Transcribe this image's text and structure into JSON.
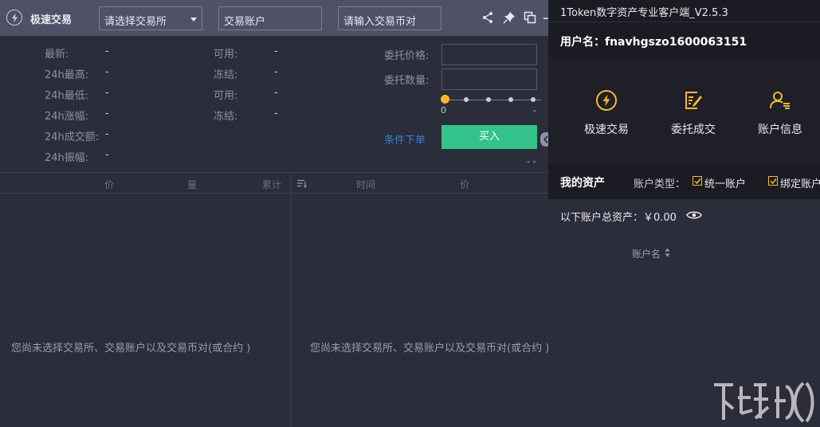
{
  "trade": {
    "title": "极速交易",
    "exchange_select": "请选择交易所",
    "account_input_placeholder": "交易账户",
    "coin_input_placeholder": "请输入交易币对",
    "stats_left": [
      {
        "label": "最新:",
        "value": "-"
      },
      {
        "label": "24h最高:",
        "value": "-"
      },
      {
        "label": "24h最低:",
        "value": "-"
      },
      {
        "label": "24h涨幅:",
        "value": "-"
      },
      {
        "label": "24h成交额:",
        "value": "-"
      },
      {
        "label": "24h振幅:",
        "value": "-"
      }
    ],
    "stats_mid": [
      {
        "label": "可用:",
        "value": "-"
      },
      {
        "label": "冻结:",
        "value": "-"
      },
      {
        "label": "可用:",
        "value": "-"
      },
      {
        "label": "冻结:",
        "value": "-"
      }
    ],
    "price_label": "委托价格:",
    "amount_label": "委托数量:",
    "slider_start": "0",
    "slider_value": 0,
    "slider_end_mark": "-",
    "condition_link": "条件下单",
    "buy_label": "买入",
    "dash_text": "- -",
    "orderbook_headers": [
      "价",
      "量",
      "累计"
    ],
    "trades_headers": [
      "时间",
      "价"
    ],
    "empty_msg_left": "您尚未选择交易所、交易账户以及交易币对(或合约 )",
    "empty_msg_right": "您尚未选择交易所、交易账户以及交易币对(或合约 )"
  },
  "account_panel": {
    "app_title": "1Token数字资产专业客户端_V2.5.3",
    "username_label": "用户名：fnavhgszo1600063151",
    "actions": [
      {
        "label": "极速交易",
        "icon": "bolt-icon"
      },
      {
        "label": "委托成交",
        "icon": "edit-note-icon"
      },
      {
        "label": "账户信息",
        "icon": "user-list-icon"
      }
    ],
    "assets_title": "我的资产",
    "account_type_label": "账户类型：",
    "checkboxes": [
      {
        "label": "统一账户",
        "checked": true
      },
      {
        "label": "绑定账户",
        "checked": true
      }
    ],
    "total_assets": "以下账户总资产：￥0.00",
    "account_name_header": "账户名"
  },
  "colors": {
    "accent": "#f5b82e",
    "buy": "#33c28b",
    "link": "#3b7fd1"
  }
}
